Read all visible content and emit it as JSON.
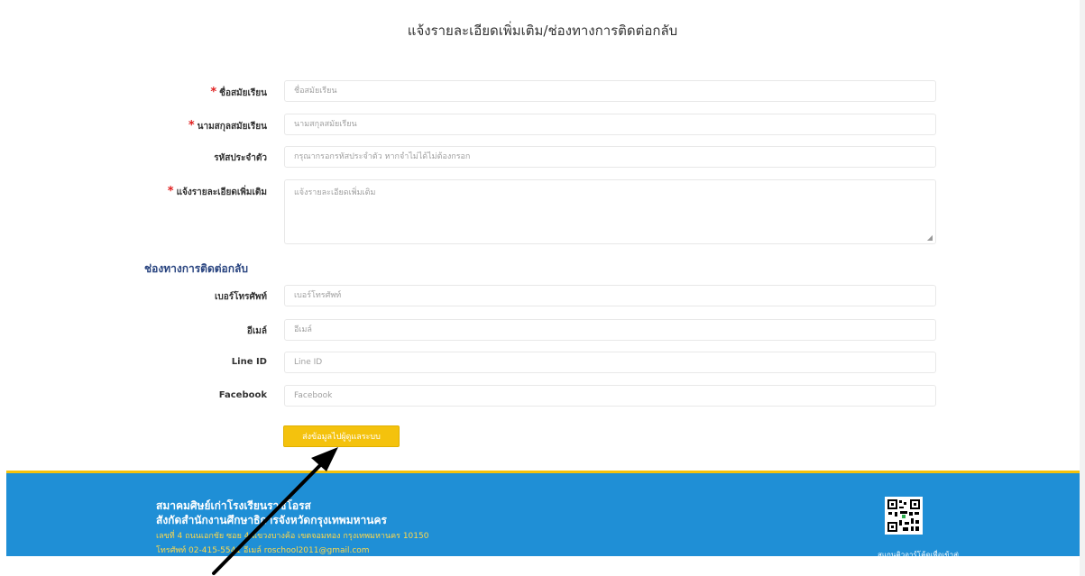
{
  "page": {
    "title": "แจ้งรายละเอียดเพิ่มเติม/ช่องทางการติดต่อกลับ"
  },
  "form": {
    "first_name": {
      "label": "ชื่อสมัยเรียน",
      "placeholder": "ชื่อสมัยเรียน",
      "required": true
    },
    "last_name": {
      "label": "นามสกุลสมัยเรียน",
      "placeholder": "นามสกุลสมัยเรียน",
      "required": true
    },
    "student_id": {
      "label": "รหัสประจำตัว",
      "placeholder": "กรุณากรอกรหัสประจำตัว หากจำไม่ได้ไม่ต้องกรอก",
      "required": false
    },
    "details": {
      "label": "แจ้งรายละเอียดเพิ่มเติม",
      "placeholder": "แจ้งรายละเอียดเพิ่มเติม",
      "required": true
    },
    "required_marker": "*"
  },
  "contact": {
    "heading": "ช่องทางการติดต่อกลับ",
    "phone": {
      "label": "เบอร์โทรศัพท์",
      "placeholder": "เบอร์โทรศัพท์"
    },
    "email": {
      "label": "อีเมล์",
      "placeholder": "อีเมล์"
    },
    "line": {
      "label": "Line ID",
      "placeholder": "Line ID"
    },
    "facebook": {
      "label": "Facebook",
      "placeholder": "Facebook"
    }
  },
  "submit": {
    "label": "ส่งข้อมูลไปผู้ดูแลระบบ"
  },
  "footer": {
    "org_name": "สมาคมศิษย์เก่าโรงเรียนราชโอรส",
    "affiliation": "สังกัดสำนักงานศึกษาธิการจังหวัดกรุงเทพมหานคร",
    "address": "เลขที่ 4 ถนนเอกชัย ซอย 4 แขวงบางค้อ เขตจอมทอง กรุงเทพมหานคร 10150",
    "contact": "โทรศัพท์ 02-415-5541 อีเมล์ roschool2011@gmail.com",
    "qr_caption": "สแกนคิวอาร์โค้ดเพื่อเข้าสู่เว็บไซต์"
  },
  "colors": {
    "accent": "#f4c20d",
    "footer_bg": "#1f8fd6",
    "footer_text_secondary": "#ffd84a",
    "required": "#e02020",
    "section_heading": "#2a4580",
    "annotation_arrow": "#000000"
  },
  "icons": {
    "qr": "qr-code-icon",
    "arrow": "pointer-arrow-icon",
    "resize": "textarea-resize-icon"
  }
}
